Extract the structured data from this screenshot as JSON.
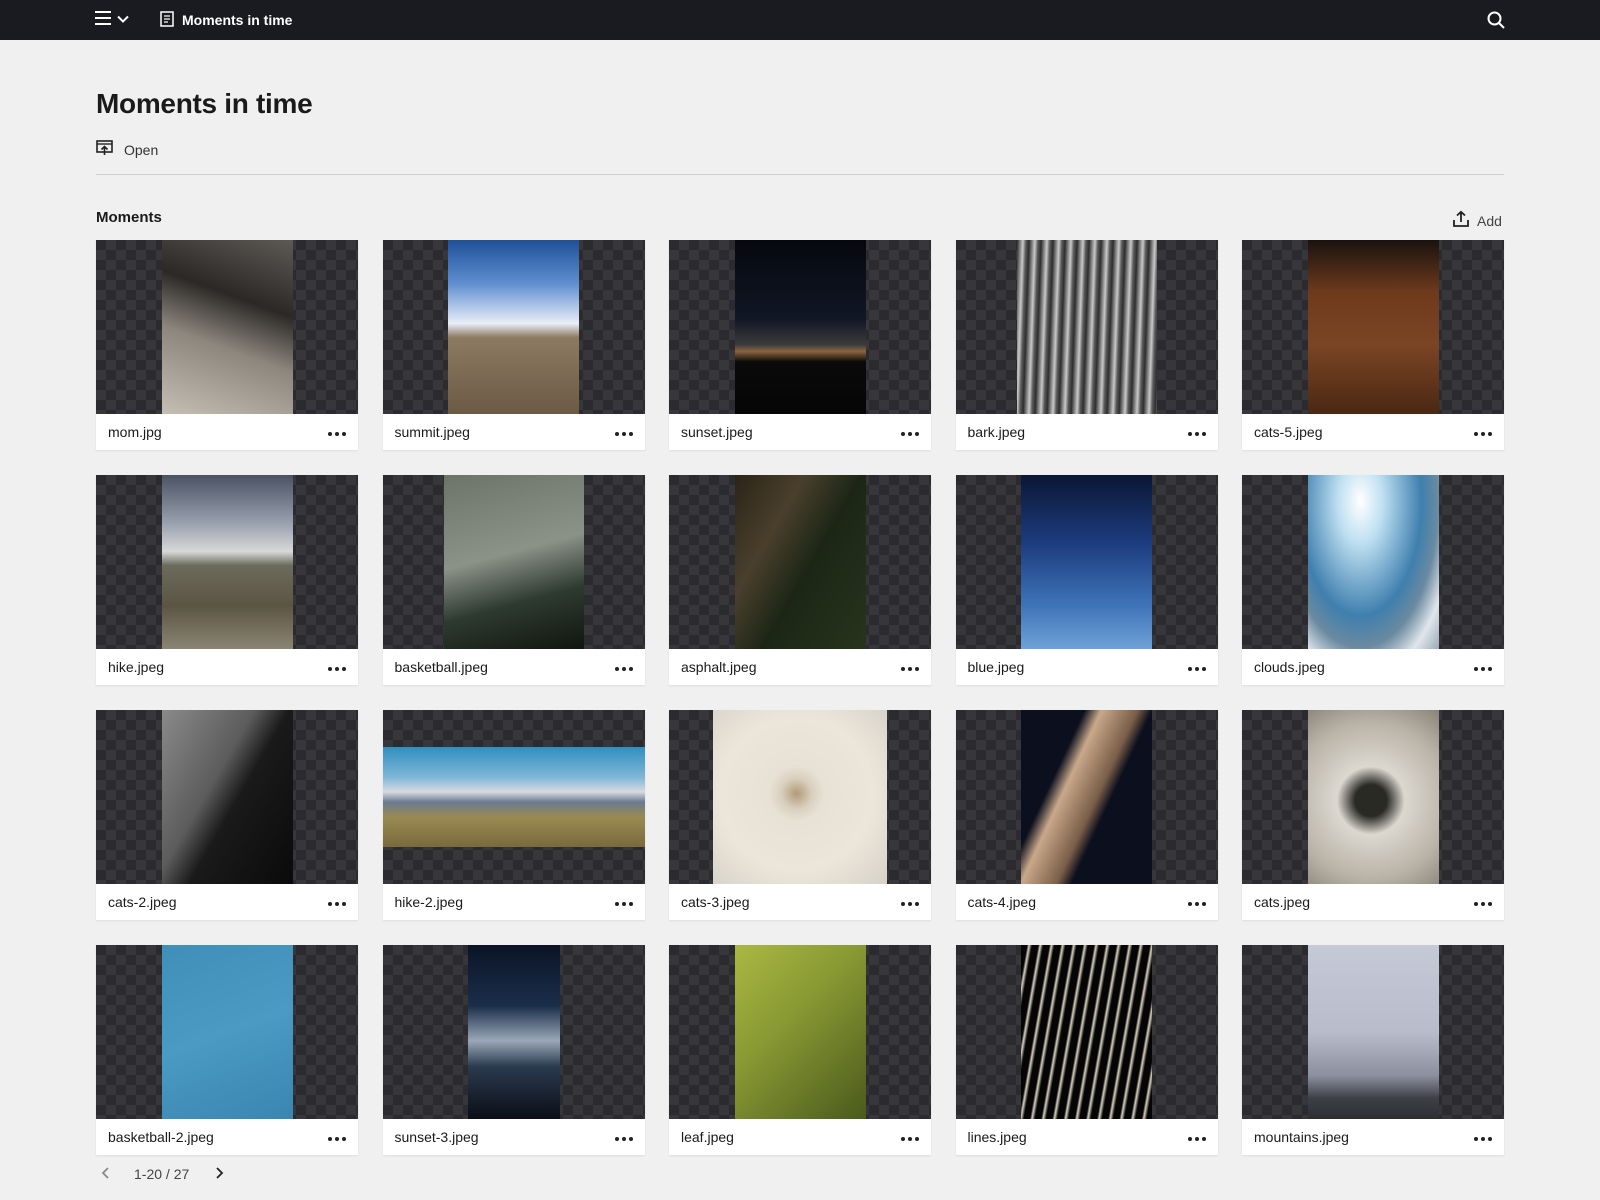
{
  "topbar": {
    "menu_icon": "hamburger-icon",
    "dropdown_icon": "chevron-down-icon",
    "doc_icon": "document-icon",
    "title": "Moments in time",
    "search_icon": "search-icon"
  },
  "page": {
    "title": "Moments in time",
    "open_label": "Open",
    "open_icon": "open-present-icon"
  },
  "section": {
    "title": "Moments",
    "add_label": "Add",
    "add_icon": "upload-icon"
  },
  "items": [
    {
      "name": "mom.jpg"
    },
    {
      "name": "summit.jpeg"
    },
    {
      "name": "sunset.jpeg"
    },
    {
      "name": "bark.jpeg"
    },
    {
      "name": "cats-5.jpeg"
    },
    {
      "name": "hike.jpeg"
    },
    {
      "name": "basketball.jpeg"
    },
    {
      "name": "asphalt.jpeg"
    },
    {
      "name": "blue.jpeg"
    },
    {
      "name": "clouds.jpeg"
    },
    {
      "name": "cats-2.jpeg"
    },
    {
      "name": "hike-2.jpeg"
    },
    {
      "name": "cats-3.jpeg"
    },
    {
      "name": "cats-4.jpeg"
    },
    {
      "name": "cats.jpeg"
    },
    {
      "name": "basketball-2.jpeg"
    },
    {
      "name": "sunset-3.jpeg"
    },
    {
      "name": "leaf.jpeg"
    },
    {
      "name": "lines.jpeg"
    },
    {
      "name": "mountains.jpeg"
    }
  ],
  "pagination": {
    "range": "1-20 / 27",
    "prev_icon": "chevron-left-icon",
    "next_icon": "chevron-right-icon"
  },
  "colors": {
    "topbar_bg": "#191b20",
    "page_bg": "#f0f0f0",
    "card_bg": "#ffffff"
  }
}
